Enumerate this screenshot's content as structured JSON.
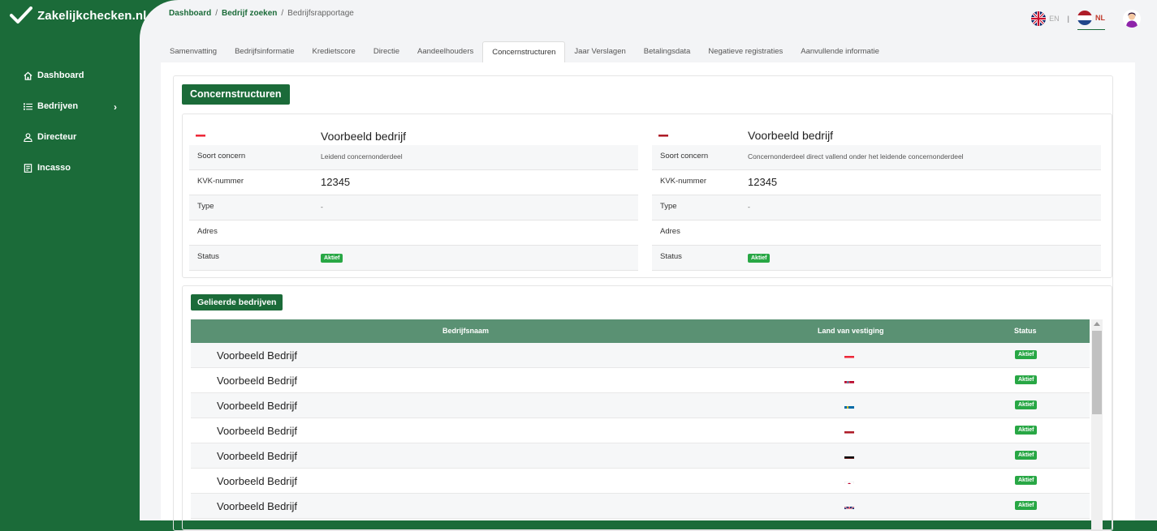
{
  "app": {
    "title": "Zakelijkchecken.nl"
  },
  "sidebar": {
    "items": [
      {
        "label": "Dashboard",
        "icon": "home-icon"
      },
      {
        "label": "Bedrijven",
        "icon": "list-icon",
        "has_submenu": true
      },
      {
        "label": "Directeur",
        "icon": "user-icon"
      },
      {
        "label": "Incasso",
        "icon": "document-icon"
      }
    ]
  },
  "breadcrumb": {
    "items": [
      "Dashboard",
      "Bedrijf zoeken"
    ],
    "current": "Bedrijfsrapportage"
  },
  "language": {
    "en": "EN",
    "nl": "NL",
    "active": "NL"
  },
  "tabs": [
    "Samenvatting",
    "Bedrijfsinformatie",
    "Kredietscore",
    "Directie",
    "Aandeelhouders",
    "Concernstructuren",
    "Jaar Verslagen",
    "Betalingsdata",
    "Negatieve registraties",
    "Aanvullende informatie"
  ],
  "active_tab": "Concernstructuren",
  "section_title": "Concernstructuren",
  "companies": [
    {
      "flag": "LU",
      "name": "Voorbeeld bedrijf",
      "rows": {
        "soort_label": "Soort concern",
        "soort": "Leidend concernonderdeel",
        "kvk_label": "KVK-nummer",
        "kvk": "12345",
        "type_label": "Type",
        "type": "-",
        "adres_label": "Adres",
        "adres": "",
        "status_label": "Status",
        "status": "Aktief"
      }
    },
    {
      "flag": "NL",
      "name": "Voorbeeld bedrijf",
      "rows": {
        "soort_label": "Soort concern",
        "soort": "Concernonderdeel direct vallend onder het leidende concernonderdeel",
        "kvk_label": "KVK-nummer",
        "kvk": "12345",
        "type_label": "Type",
        "type": "-",
        "adres_label": "Adres",
        "adres": "",
        "status_label": "Status",
        "status": "Aktief"
      }
    }
  ],
  "related": {
    "title": "Gelieerde bedrijven",
    "columns": [
      "Bedrijfsnaam",
      "Land van vestiging",
      "Status"
    ],
    "rows": [
      {
        "name": "Voorbeeld Bedrijf",
        "country": "LU",
        "status": "Aktief"
      },
      {
        "name": "Voorbeeld Bedrijf",
        "country": "NO",
        "status": "Aktief"
      },
      {
        "name": "Voorbeeld Bedrijf",
        "country": "SE",
        "status": "Aktief"
      },
      {
        "name": "Voorbeeld Bedrijf",
        "country": "NL",
        "status": "Aktief"
      },
      {
        "name": "Voorbeeld Bedrijf",
        "country": "DE",
        "status": "Aktief"
      },
      {
        "name": "Voorbeeld Bedrijf",
        "country": "JP",
        "status": "Aktief"
      },
      {
        "name": "Voorbeeld Bedrijf",
        "country": "GB",
        "status": "Aktief"
      }
    ]
  },
  "colors": {
    "brand": "#1b6b39",
    "status": "#28a745",
    "table_header": "#5a9173"
  }
}
